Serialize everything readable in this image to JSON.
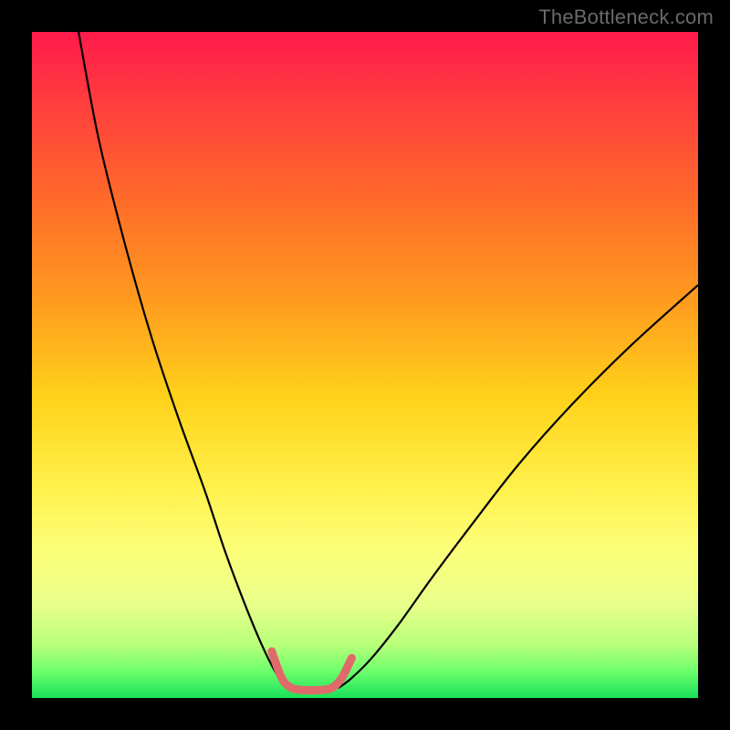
{
  "watermark": "TheBottleneck.com",
  "chart_data": {
    "type": "line",
    "title": "",
    "xlabel": "",
    "ylabel": "",
    "xlim": [
      0,
      100
    ],
    "ylim": [
      0,
      100
    ],
    "description": "V-shaped bottleneck curve over a vertical rainbow gradient background (red at top through orange, yellow, to green at bottom). Two black curve arms descend to a small flat valley near the bottom. A short salmon/pink segment overlays the valley bottom.",
    "gradient_stops": [
      {
        "offset": 0.0,
        "color": "#ff1a4b"
      },
      {
        "offset": 0.1,
        "color": "#ff3b3f"
      },
      {
        "offset": 0.25,
        "color": "#ff6a2a"
      },
      {
        "offset": 0.4,
        "color": "#ff9a1f"
      },
      {
        "offset": 0.55,
        "color": "#ffd21a"
      },
      {
        "offset": 0.68,
        "color": "#fff04a"
      },
      {
        "offset": 0.78,
        "color": "#fcff7a"
      },
      {
        "offset": 0.86,
        "color": "#e8ff8a"
      },
      {
        "offset": 0.92,
        "color": "#b8ff7a"
      },
      {
        "offset": 0.96,
        "color": "#6cff6c"
      },
      {
        "offset": 1.0,
        "color": "#18e05a"
      }
    ],
    "series": [
      {
        "name": "left-arm",
        "color": "#000000",
        "x": [
          7,
          10,
          14,
          18,
          22,
          26,
          29,
          32,
          34.5,
          36.5,
          38,
          39
        ],
        "y": [
          100,
          84,
          68,
          54,
          42,
          31,
          22,
          14,
          8,
          4,
          2,
          1.5
        ]
      },
      {
        "name": "right-arm",
        "color": "#000000",
        "x": [
          46,
          48,
          51,
          55,
          60,
          66,
          73,
          81,
          90,
          100
        ],
        "y": [
          1.5,
          3,
          6,
          11,
          18,
          26,
          35,
          44,
          53,
          62
        ]
      },
      {
        "name": "valley-highlight",
        "color": "#e06a6a",
        "x": [
          36,
          37.5,
          39,
          41,
          43,
          45,
          46.5,
          48
        ],
        "y": [
          7,
          3,
          1.5,
          1.2,
          1.2,
          1.5,
          3,
          6
        ]
      }
    ],
    "valley_x_range": [
      39,
      46
    ],
    "valley_y": 1.3
  }
}
